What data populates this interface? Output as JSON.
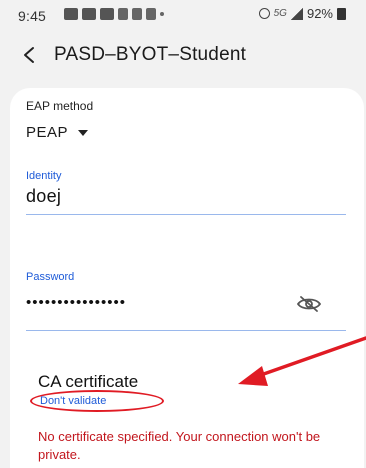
{
  "status_bar": {
    "time": "9:45",
    "network": "5G",
    "battery": "92%"
  },
  "header": {
    "title": "PASD–BYOT–Student"
  },
  "form": {
    "eap_method_label": "EAP method",
    "eap_method_value": "PEAP",
    "identity_label": "Identity",
    "identity_value": "doej",
    "password_label": "Password",
    "password_value": "••••••••••••••••",
    "ca_certificate_label": "CA certificate",
    "ca_certificate_value": "Don't validate",
    "warning": "No certificate specified. Your connection won't be private."
  },
  "icons": {
    "back": "back-arrow-icon",
    "dropdown": "dropdown-triangle-icon",
    "password_toggle": "eye-off-icon"
  },
  "colors": {
    "accent_blue": "#1e5bd8",
    "warning_red": "#c2161d",
    "annotation_red": "#e01b24"
  }
}
